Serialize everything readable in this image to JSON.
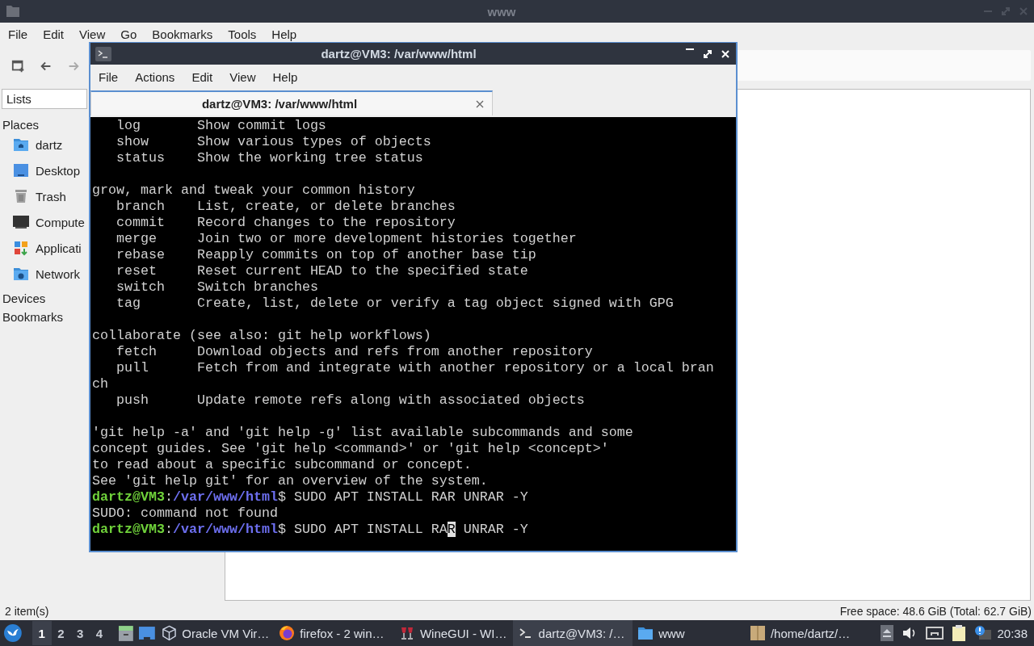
{
  "file_manager": {
    "title": "www",
    "menu": [
      "File",
      "Edit",
      "View",
      "Go",
      "Bookmarks",
      "Tools",
      "Help"
    ],
    "toolbar": [
      {
        "kind": "new-tab",
        "disabled": false
      },
      {
        "kind": "back",
        "disabled": false
      },
      {
        "kind": "forward",
        "disabled": true
      }
    ],
    "sidebar": {
      "view": "Lists",
      "sections": [
        {
          "label": "Places",
          "items": [
            {
              "label": "dartz",
              "kind": "home"
            },
            {
              "label": "Desktop",
              "kind": "desktop"
            },
            {
              "label": "Trash",
              "kind": "trash"
            },
            {
              "label": "Compute",
              "kind": "computer"
            },
            {
              "label": "Applicati",
              "kind": "apps"
            },
            {
              "label": "Network",
              "kind": "network"
            }
          ]
        },
        {
          "label": "Devices"
        },
        {
          "label": "Bookmarks"
        }
      ]
    },
    "status": {
      "items": "2 item(s)",
      "free_space": "Free space: 48.6 GiB (Total: 62.7 GiB)"
    }
  },
  "terminal": {
    "title": "dartz@VM3: /var/www/html",
    "menu": [
      "File",
      "Actions",
      "Edit",
      "View",
      "Help"
    ],
    "tab": {
      "label": "dartz@VM3: /var/www/html",
      "selected": true
    },
    "lines": [
      {
        "kind": "text",
        "text": "   log       Show commit logs"
      },
      {
        "kind": "text",
        "text": "   show      Show various types of objects"
      },
      {
        "kind": "text",
        "text": "   status    Show the working tree status"
      },
      {
        "kind": "blank"
      },
      {
        "kind": "text",
        "text": "grow, mark and tweak your common history"
      },
      {
        "kind": "text",
        "text": "   branch    List, create, or delete branches"
      },
      {
        "kind": "text",
        "text": "   commit    Record changes to the repository"
      },
      {
        "kind": "text",
        "text": "   merge     Join two or more development histories together"
      },
      {
        "kind": "text",
        "text": "   rebase    Reapply commits on top of another base tip"
      },
      {
        "kind": "text",
        "text": "   reset     Reset current HEAD to the specified state"
      },
      {
        "kind": "text",
        "text": "   switch    Switch branches"
      },
      {
        "kind": "text",
        "text": "   tag       Create, list, delete or verify a tag object signed with GPG"
      },
      {
        "kind": "blank"
      },
      {
        "kind": "text",
        "text": "collaborate (see also: git help workflows)"
      },
      {
        "kind": "text",
        "text": "   fetch     Download objects and refs from another repository"
      },
      {
        "kind": "text",
        "text": "   pull      Fetch from and integrate with another repository or a local bran"
      },
      {
        "kind": "text",
        "text": "ch"
      },
      {
        "kind": "text",
        "text": "   push      Update remote refs along with associated objects"
      },
      {
        "kind": "blank"
      },
      {
        "kind": "text",
        "text": "'git help -a' and 'git help -g' list available subcommands and some"
      },
      {
        "kind": "text",
        "text": "concept guides. See 'git help <command>' or 'git help <concept>'"
      },
      {
        "kind": "text",
        "text": "to read about a specific subcommand or concept."
      },
      {
        "kind": "text",
        "text": "See 'git help git' for an overview of the system."
      },
      {
        "kind": "prompt",
        "segments": [
          {
            "kind": "user",
            "text": "dartz@VM3"
          },
          {
            "kind": "plain",
            "text": ":"
          },
          {
            "kind": "path",
            "text": "/var/www/html"
          },
          {
            "kind": "plain",
            "text": "$ SUDO APT INSTALL RAR UNRAR -Y"
          }
        ]
      },
      {
        "kind": "text",
        "text": "SUDO: command not found"
      },
      {
        "kind": "prompt",
        "segments": [
          {
            "kind": "user",
            "text": "dartz@VM3"
          },
          {
            "kind": "plain",
            "text": ":"
          },
          {
            "kind": "path",
            "text": "/var/www/html"
          },
          {
            "kind": "plain",
            "text": "$ SUDO APT INSTALL RA"
          },
          {
            "kind": "cursor",
            "text": "R"
          },
          {
            "kind": "plain",
            "text": " UNRAR -Y"
          }
        ]
      }
    ]
  },
  "taskbar": {
    "workspaces": [
      {
        "label": "1",
        "selected": true
      },
      {
        "label": "2",
        "selected": false
      },
      {
        "label": "3",
        "selected": false
      },
      {
        "label": "4",
        "selected": false
      }
    ],
    "tasks": [
      {
        "label": "Oracle VM Vir…",
        "kind": "cube",
        "selected": false
      },
      {
        "label": "firefox - 2 win…",
        "kind": "firefox",
        "selected": false
      },
      {
        "label": "WineGUI - WI…",
        "kind": "wine",
        "selected": false
      },
      {
        "label": "dartz@VM3: /…",
        "kind": "terminal",
        "selected": true
      },
      {
        "label": "www",
        "kind": "folder",
        "selected": false
      }
    ],
    "tray_task": {
      "label": "/home/dartz/…",
      "kind": "archive",
      "selected": false
    },
    "clock": "20:38"
  }
}
